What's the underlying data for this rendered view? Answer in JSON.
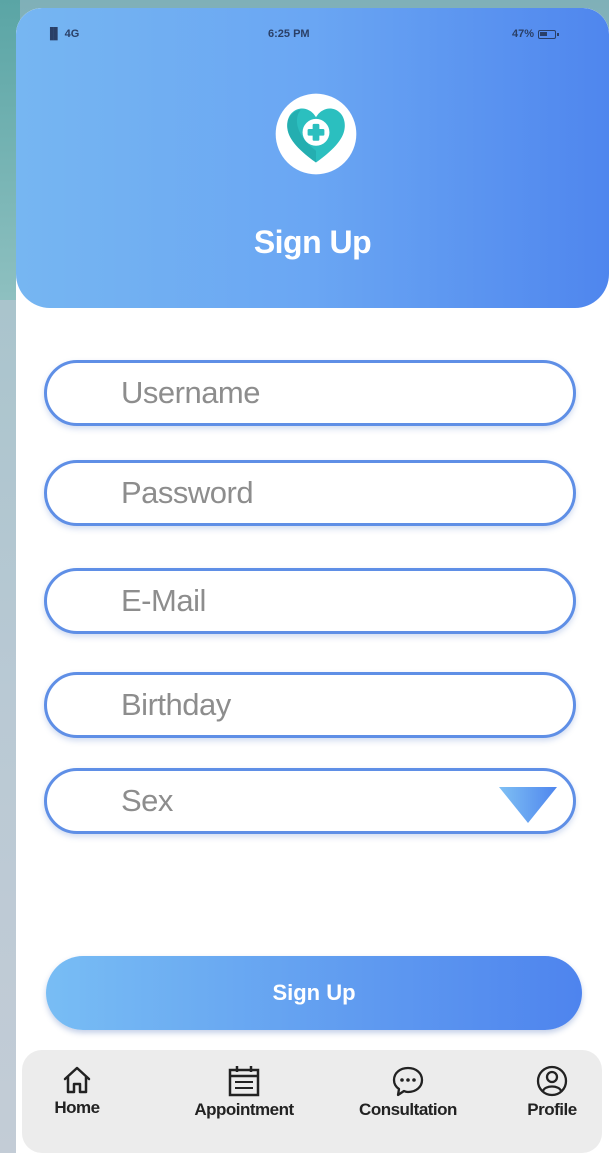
{
  "status_bar": {
    "signal": "▐▌ 4G",
    "time": "6:25 PM",
    "battery": "47%"
  },
  "header": {
    "title": "Sign Up"
  },
  "form": {
    "username_placeholder": "Username",
    "password_placeholder": "Password",
    "email_placeholder": "E-Mail",
    "birthday_placeholder": "Birthday",
    "sex_placeholder": "Sex"
  },
  "submit_label": "Sign Up",
  "nav": {
    "items": [
      {
        "label": "Home",
        "icon": "home-icon"
      },
      {
        "label": "Appointment",
        "icon": "calendar-icon"
      },
      {
        "label": "Consultation",
        "icon": "chat-icon"
      },
      {
        "label": "Profile",
        "icon": "user-icon"
      }
    ]
  },
  "colors": {
    "accent": "#5f8fe6",
    "header_start": "#76b6f2",
    "header_end": "#4f86ee",
    "logo": "#2bbfbf"
  }
}
